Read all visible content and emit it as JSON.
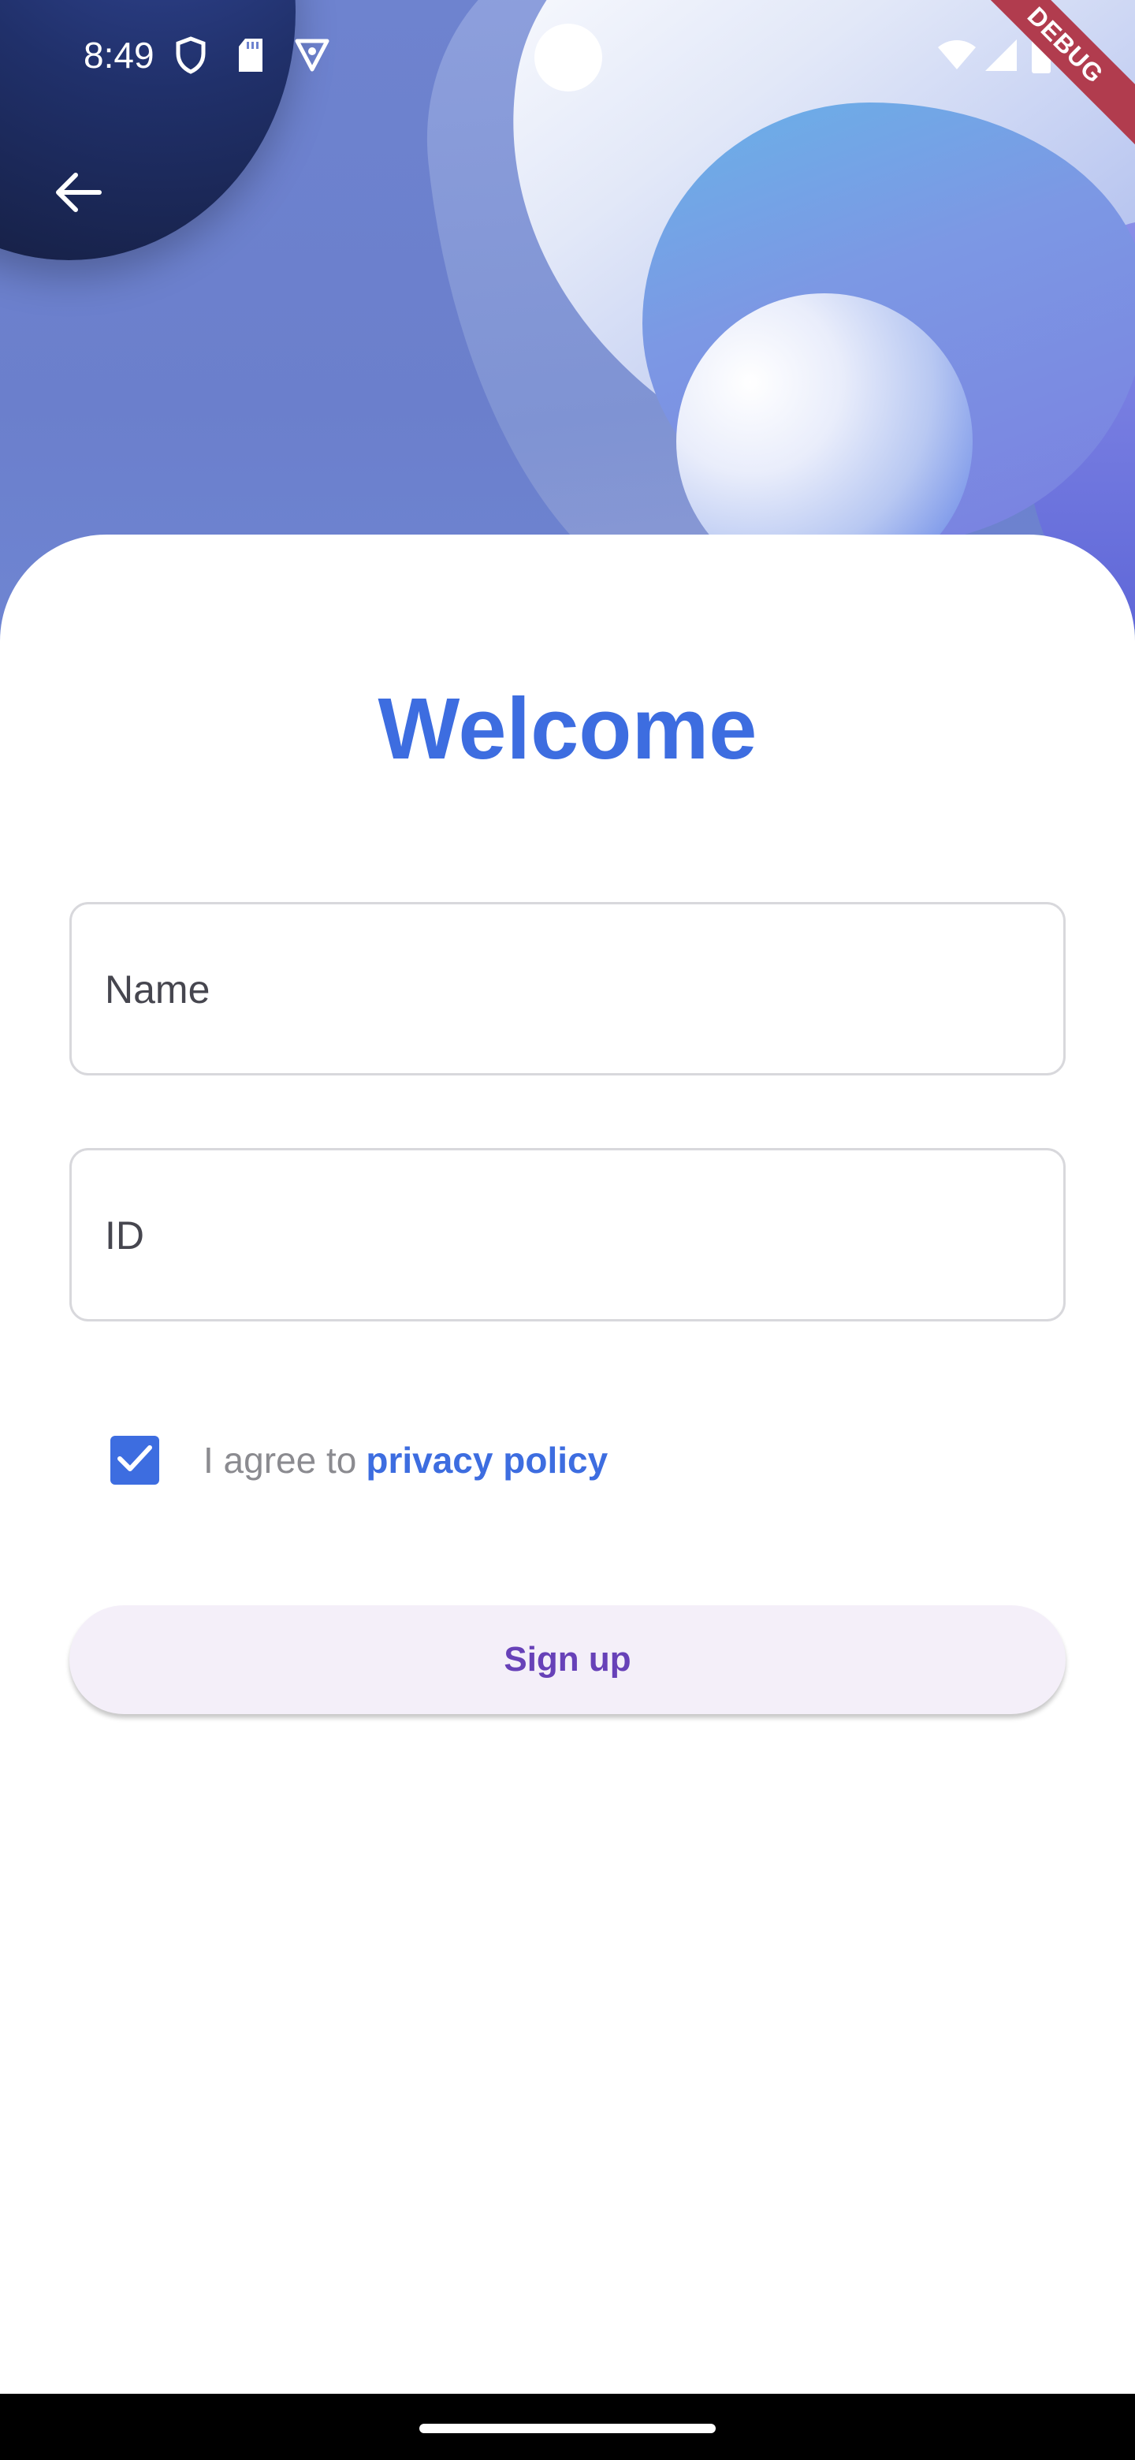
{
  "status_bar": {
    "time": "8:49",
    "icons": [
      "shield-icon",
      "sd-card-icon",
      "vpn-badge-icon",
      "wifi-icon",
      "signal-icon",
      "battery-icon"
    ]
  },
  "debug_banner": "DEBUG",
  "header": {
    "back_icon": "arrow-back-icon"
  },
  "form": {
    "title": "Welcome",
    "name_placeholder": "Name",
    "id_placeholder": "ID",
    "agree_text": "I agree to",
    "policy_link": "privacy policy",
    "checkbox_checked": true,
    "signup_label": "Sign up"
  },
  "colors": {
    "accent": "#3d6de0",
    "button_bg": "#f4eff9",
    "button_text": "#6741b8",
    "debug_banner": "#b13c4e"
  }
}
